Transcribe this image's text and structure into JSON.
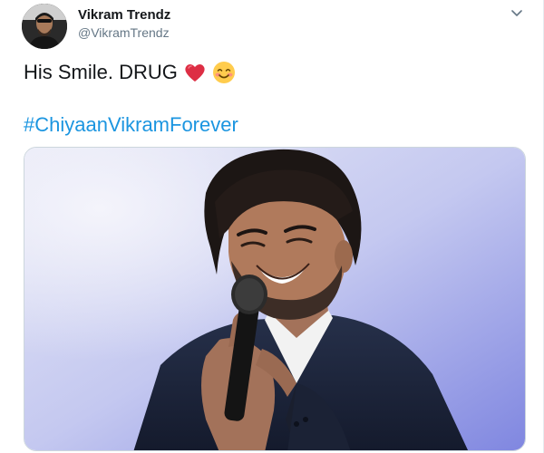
{
  "tweet": {
    "display_name": "Vikram Trendz",
    "handle": "@VikramTrendz",
    "text": "His Smile. DRUG",
    "emojis": [
      "red-heart",
      "smiling-face-with-smiling-eyes"
    ],
    "hashtag": "#ChiyaanVikramForever"
  },
  "icons": {
    "menu": "chevron-down-icon"
  },
  "colors": {
    "hashtag": "#1b95e0",
    "name": "#14171a",
    "handle": "#657786",
    "heart": "#dd2e44"
  }
}
